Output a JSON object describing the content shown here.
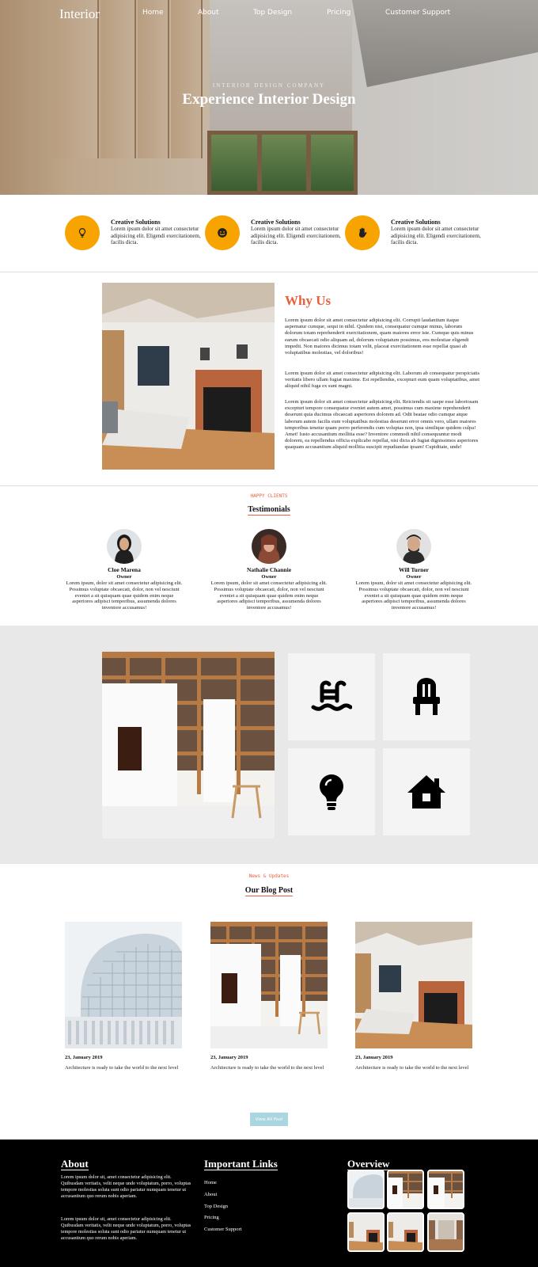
{
  "header": {
    "logo": "Interior",
    "nav": [
      "Home",
      "About",
      "Top Design",
      "Pricing",
      "Customer Support"
    ],
    "kicker": "INTERIOR DESIGN COMPANY",
    "title": "Experience Interior Design"
  },
  "features": [
    {
      "icon": "lightbulb-icon",
      "title": "Creative Solutions",
      "text": "Lorem ipsum dolor sit amet consectetur adipisicing elit. Eligendi exercitationem, facilis dicta."
    },
    {
      "icon": "smile-icon",
      "title": "Creative Solutions",
      "text": "Lorem ipsum dolor sit amet consectetur adipisicing elit. Eligendi exercitationem, facilis dicta."
    },
    {
      "icon": "hand-wave-icon",
      "title": "Creative Solutions",
      "text": "Lorem ipsum dolor sit amet consectetur adipisicing elit. Eligendi exercitationem, facilis dicta."
    }
  ],
  "why_us": {
    "title": "Why Us",
    "paragraphs": [
      "Lorem ipsum dolor sit amet consectetur adipisicing elit. Corrupti laudantium itaque aspernatur cumque, sequi in nihil. Quidem nisi, consequatur cumque minus, laborum dolorum totam reprehenderit exercitationem, quam maiores error iste. Cumque quis minus earum obcaecati odio aliquam ad, dolorum voluptatum possimus, eos molestiae eligendi impedit. Non maiores dicimus totam velit, placeat exercitationem esse repellat quasi ab voluptatibus molestias, vel doloribus!",
      "Lorem ipsum dolor sit amet consectetur adipisicing elit. Laborum ab consequatur perspiciatis veritatis libero ullam fugiat maxime. Est repellendus, excepturi eum quam voluptatibus, amet aliquid nihil fuga ex sunt magni.",
      "Lorem ipsum dolor sit amet consectetur adipisicing elit. Reiciendis sit saepe esse laboriosam excepturi tempore consequatur eveniet autem amet, possimus cum maxime reprehenderit deserunt quia ducimus obcaecati asperiores dolorem ad. Odit beatae odio cumque atque laborum autem facilis eum voluptatibus molestias deserunt error omnis vero, ullam maiores temporibus tenetur quam porro perferendis cum voluptas non, ipsa similique quidem culpa! Amet! Iusto accusantium mollitia esse? Inventore commodi nihil consequuntur modi dolorem, ea repellendus officia explicabo repellat, nisi dicta ab fugiat dignissimos asperiores quaquam accusantium aliquid mollitia suscipit repudiandae ipsam! Cupiditate, unde!"
    ]
  },
  "testimonials": {
    "kicker": "HAPPY CLIENTS",
    "title": "Testimonials",
    "people": [
      {
        "name": "Cloe Marena",
        "role": "Owner",
        "text": "Lorem ipsum, dolor sit amet consectetur adipisicing elit. Possimus voluptate obcaecati, dolor, non vel nesciunt eveniet a sit quisquam quae quidem enim neque asperiores adipisci temporibus, assumenda dolores inventore accusamus!"
      },
      {
        "name": "Nathalie Channie",
        "role": "Owner",
        "text": "Lorem ipsum, dolor sit amet consectetur adipisicing elit. Possimus voluptate obcaecati, dolor, non vel nesciunt eveniet a sit quisquam quae quidem enim neque asperiores adipisci temporibus, assumenda dolores inventore accusamus!"
      },
      {
        "name": "Will Turner",
        "role": "Owner",
        "text": "Lorem ipsum, dolor sit amet consectetur adipisicing elit. Possimus voluptate obcaecati, dolor, non vel nesciunt eveniet a sit quisquam quae quidem enim neque asperiores adipisci temporibus, assumenda dolores inventore accusamus!"
      }
    ]
  },
  "services": {
    "icons": [
      "swimming-pool-icon",
      "chair-icon",
      "lightbulb-icon",
      "house-icon"
    ]
  },
  "blog": {
    "kicker": "News & Updates",
    "title": "Our Blog Post",
    "posts": [
      {
        "date": "23, January 2019",
        "text": "Architecture is ready to take the world to the next level"
      },
      {
        "date": "23, January 2019",
        "text": "Architecture is ready to take the world to the next level"
      },
      {
        "date": "23, January 2019",
        "text": "Architecture is ready to take the world to the next level"
      }
    ],
    "button": "View All Post"
  },
  "footer": {
    "about_title": "About",
    "about_p1": "Lorem ipsum dolor sit, amet consectetur adipisicing elit. Quibusdam veritatis, velit neque unde voluptatum, porro, voluptas tempore molestias soluta sunt odio pariatur numquam tenetur ut accusantium quo rerum nobis aperiam.",
    "about_p2": "Lorem ipsum dolor sit, amet consectetur adipisicing elit. Quibusdam veritatis, velit neque unde voluptatum, porro, voluptas tempore molestias soluta sunt odio pariatur numquam tenetur ut accusantium quo rerum nobis aperiam.",
    "links_title": "Important Links",
    "links": [
      "Home",
      "About",
      "Top Design",
      "Pricing",
      "Customer Support"
    ],
    "overview_title": "Overview"
  },
  "colors": {
    "accent": "#e8603c",
    "feature_circle": "#f7a400",
    "button": "#a9d6e0",
    "services_bg": "#e8e8e8",
    "footer_bg": "#000000"
  }
}
